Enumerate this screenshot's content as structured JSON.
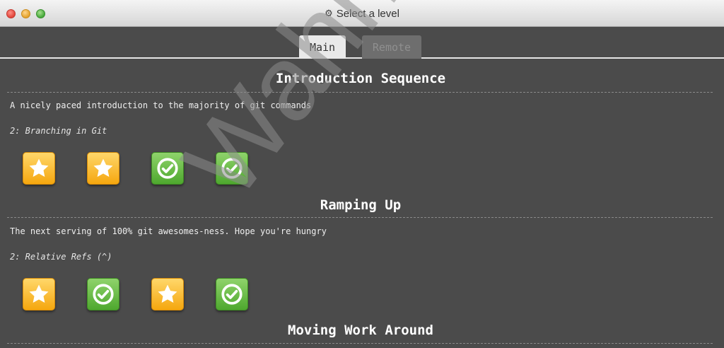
{
  "window": {
    "title": "Select a level",
    "title_icon": "gear-icon"
  },
  "tabs": [
    {
      "label": "Main",
      "selected": true
    },
    {
      "label": "Remote",
      "selected": false
    }
  ],
  "sections": [
    {
      "title": "Introduction Sequence",
      "description": "A nicely paced introduction to the majority of git commands",
      "current": "2: Branching in Git",
      "levels": [
        {
          "icon": "star-icon",
          "status": "star"
        },
        {
          "icon": "star-icon",
          "status": "star"
        },
        {
          "icon": "check-icon",
          "status": "check"
        },
        {
          "icon": "check-icon",
          "status": "check"
        }
      ]
    },
    {
      "title": "Ramping Up",
      "description": "The next serving of 100% git awesomes-ness. Hope you're hungry",
      "current": "2: Relative Refs (^)",
      "levels": [
        {
          "icon": "star-icon",
          "status": "star"
        },
        {
          "icon": "check-icon",
          "status": "check"
        },
        {
          "icon": "star-icon",
          "status": "star"
        },
        {
          "icon": "check-icon",
          "status": "check"
        }
      ]
    },
    {
      "title": "Moving Work Around"
    }
  ],
  "watermark": "Wahhab",
  "colors": {
    "background": "#4b4b4b",
    "star_level": "#f5a70f",
    "check_level": "#4ea82e"
  }
}
